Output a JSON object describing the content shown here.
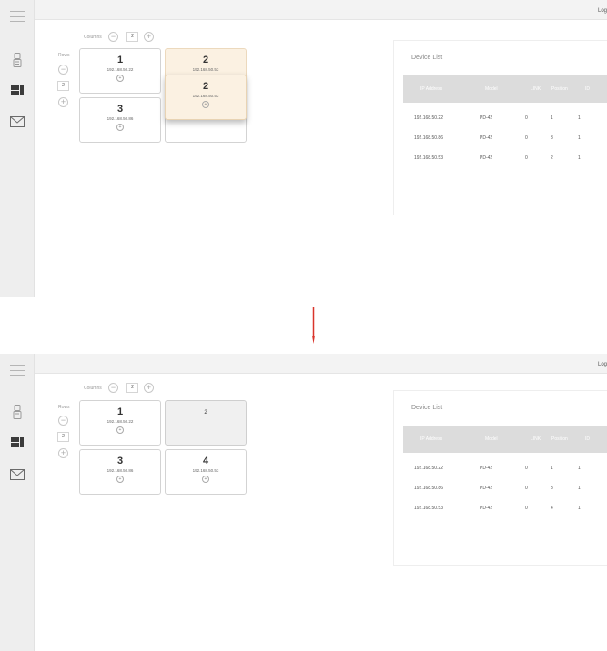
{
  "header": {
    "logout_label": "Log"
  },
  "sidebar": {
    "icons": [
      "device-icon",
      "grid-layout-icon",
      "mail-icon"
    ]
  },
  "grid_controls": {
    "columns_label": "Columns",
    "columns_value": "2",
    "rows_label": "Rows",
    "rows_value": "2"
  },
  "device_list": {
    "title": "Device List",
    "columns": [
      "IP Address",
      "Model",
      "LINK",
      "Position",
      "ID"
    ]
  },
  "before": {
    "tiles": {
      "t1": {
        "number": "1",
        "ip": "192.168.50.22"
      },
      "t2": {
        "number": "2",
        "ip": "192.168.50.53"
      },
      "t2_drag": {
        "number": "2",
        "ip": "192.168.50.53"
      },
      "t3": {
        "number": "3",
        "ip": "192.168.50.86"
      }
    },
    "rows": [
      {
        "ip": "192.168.50.22",
        "model": "PD-42",
        "link": "0",
        "position": "1",
        "id": "1"
      },
      {
        "ip": "192.168.50.86",
        "model": "PD-42",
        "link": "0",
        "position": "3",
        "id": "1"
      },
      {
        "ip": "192.168.50.53",
        "model": "PD-42",
        "link": "0",
        "position": "2",
        "id": "1"
      }
    ]
  },
  "after": {
    "tiles": {
      "t1": {
        "number": "1",
        "ip": "192.168.50.22"
      },
      "t2": {
        "number": "2"
      },
      "t3": {
        "number": "3",
        "ip": "192.168.50.86"
      },
      "t4": {
        "number": "4",
        "ip": "192.168.50.53"
      }
    },
    "rows": [
      {
        "ip": "192.168.50.22",
        "model": "PD-42",
        "link": "0",
        "position": "1",
        "id": "1"
      },
      {
        "ip": "192.168.50.86",
        "model": "PD-42",
        "link": "0",
        "position": "3",
        "id": "1"
      },
      {
        "ip": "192.168.50.53",
        "model": "PD-42",
        "link": "0",
        "position": "4",
        "id": "1"
      }
    ]
  },
  "colors": {
    "arrow": "#d9342b",
    "drag_tile": "#fbf1e2",
    "empty_tile": "#f0f0f0",
    "table_header": "#dcdcdc"
  }
}
